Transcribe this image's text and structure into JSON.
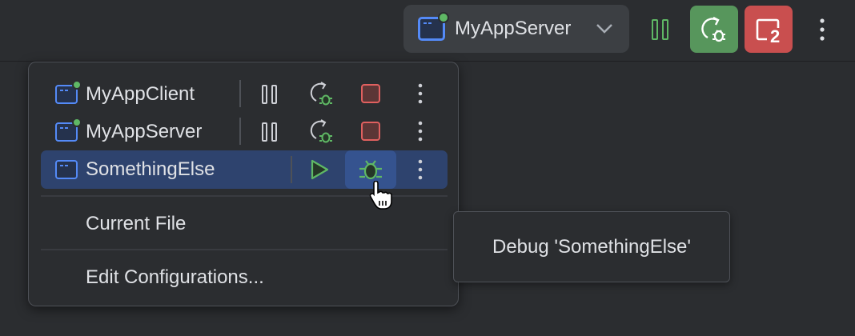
{
  "toolbar": {
    "run_config": "MyAppServer",
    "icons": [
      "app-icon",
      "chevron-down-icon",
      "pause-icon",
      "rerun-debug-icon",
      "stop-icon",
      "more-icon"
    ],
    "stop_count": "2",
    "colors": {
      "debug": "#57965c",
      "stop": "#c94f4f",
      "accent": "#548af7"
    }
  },
  "popup": {
    "configs": [
      {
        "name": "MyAppClient",
        "running": true
      },
      {
        "name": "MyAppServer",
        "running": true
      },
      {
        "name": "SomethingElse",
        "running": false,
        "selected": true
      }
    ],
    "items": [
      "Current File",
      "Edit Configurations..."
    ]
  },
  "tooltip": "Debug 'SomethingElse'"
}
